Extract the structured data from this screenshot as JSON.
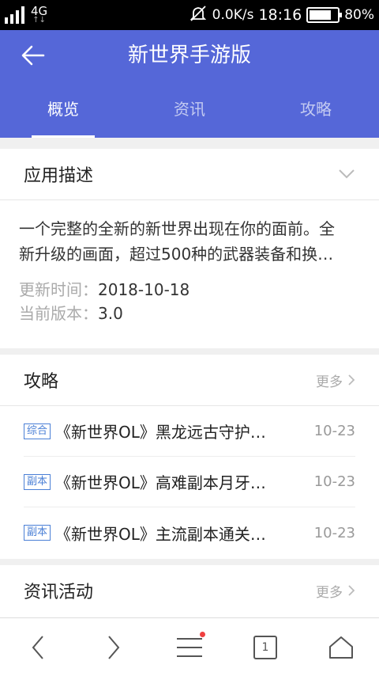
{
  "status_bar": {
    "network": "4G",
    "speed": "0.0K/s",
    "time": "18:16",
    "battery": "80%",
    "battery_level": 0.8
  },
  "header": {
    "title": "新世界手游版",
    "tabs": [
      {
        "label": "概览",
        "active": true
      },
      {
        "label": "资讯",
        "active": false
      },
      {
        "label": "攻略",
        "active": false
      }
    ],
    "accent_color": "#5567d8"
  },
  "description": {
    "title": "应用描述",
    "text_line1": "一个完整的全新的新世界出现在你的面前。全",
    "text_line2": "新升级的画面，超过500种的武器装备和换…",
    "update_label": "更新时间：",
    "update_value": "2018-10-18",
    "version_label": "当前版本：",
    "version_value": "3.0"
  },
  "guides": {
    "title": "攻略",
    "more": "更多",
    "items": [
      {
        "tag": "综合",
        "title": "《新世界OL》黑龙远古守护…",
        "date": "10-23"
      },
      {
        "tag": "副本",
        "title": "《新世界OL》高难副本月牙…",
        "date": "10-23"
      },
      {
        "tag": "副本",
        "title": "《新世界OL》主流副本通关…",
        "date": "10-23"
      }
    ]
  },
  "news": {
    "title": "资讯活动",
    "more": "更多"
  },
  "bottom_bar": {
    "tab_count": "1"
  }
}
